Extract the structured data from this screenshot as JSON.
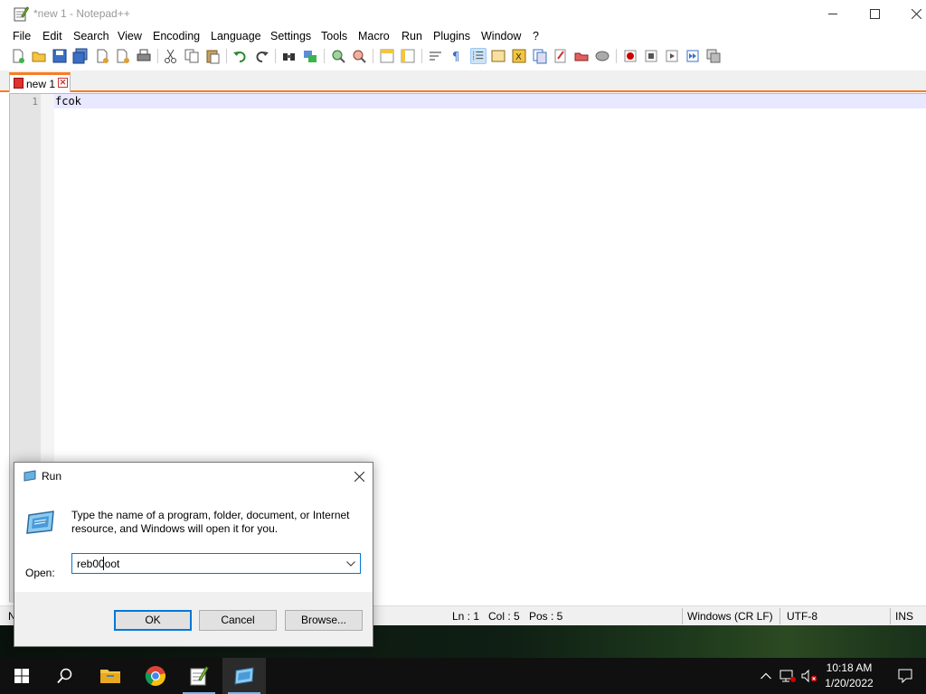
{
  "window": {
    "title": "*new 1 - Notepad++",
    "app_icon": "notepadpp-icon"
  },
  "menu": [
    "File",
    "Edit",
    "Search",
    "View",
    "Encoding",
    "Language",
    "Settings",
    "Tools",
    "Macro",
    "Run",
    "Plugins",
    "Window",
    "?"
  ],
  "tabs": [
    {
      "label": "new 1",
      "modified": true
    }
  ],
  "editor": {
    "lines": [
      {
        "number": "1",
        "text": "fcok"
      }
    ]
  },
  "status": {
    "left_fragment": "N",
    "ln": "Ln : 1",
    "col": "Col : 5",
    "pos": "Pos : 5",
    "eol": "Windows (CR LF)",
    "encoding": "UTF-8",
    "mode": "INS"
  },
  "run_dialog": {
    "title": "Run",
    "description": "Type the name of a program, folder, document, or Internet resource, and Windows will open it for you.",
    "open_label": "Open:",
    "open_value": "reb00oot",
    "ok_label": "OK",
    "cancel_label": "Cancel",
    "browse_label": "Browse..."
  },
  "taskbar": {
    "items": [
      "start-icon",
      "search-icon",
      "file-explorer-icon",
      "chrome-icon",
      "notepadpp-icon",
      "run-icon"
    ],
    "time": "10:18 AM",
    "date": "1/20/2022"
  },
  "colors": {
    "accent": "#0078d7",
    "tab_accent": "#fa7b24",
    "current_line": "#e8e8ff"
  }
}
